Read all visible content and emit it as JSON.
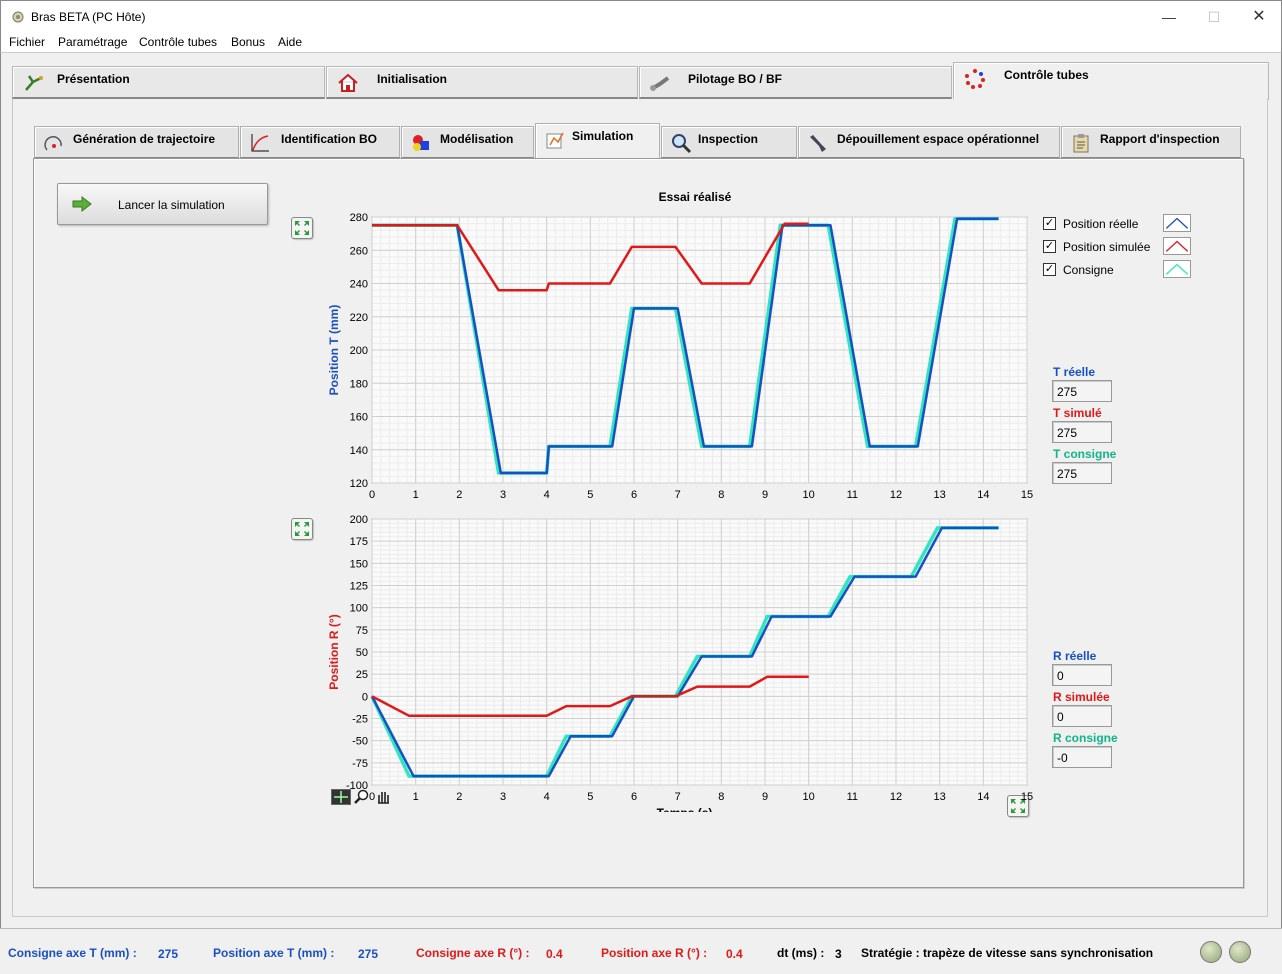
{
  "window": {
    "title": "Bras BETA (PC Hôte)",
    "min_icon": "minimize-icon",
    "max_icon": "maximize-icon",
    "close_icon": "close-icon"
  },
  "menu": [
    "Fichier",
    "Paramétrage",
    "Contrôle tubes",
    "Bonus",
    "Aide"
  ],
  "main_tabs": [
    {
      "label": "Présentation",
      "icon": "presentation-icon"
    },
    {
      "label": "Initialisation",
      "icon": "house-icon"
    },
    {
      "label": "Pilotage BO / BF",
      "icon": "robot-arm-icon"
    },
    {
      "label": "Contrôle tubes",
      "icon": "circle-dots-icon",
      "active": true
    }
  ],
  "sub_tabs": [
    {
      "label": "Génération de trajectoire",
      "icon": "trajectory-icon"
    },
    {
      "label": "Identification BO",
      "icon": "graph-icon"
    },
    {
      "label": "Modélisation",
      "icon": "shapes-icon"
    },
    {
      "label": "Simulation",
      "icon": "simulation-icon",
      "active": true
    },
    {
      "label": "Inspection",
      "icon": "magnifier-icon"
    },
    {
      "label": "Dépouillement espace opérationnel",
      "icon": "tools-icon"
    },
    {
      "label": "Rapport d'inspection",
      "icon": "clipboard-icon"
    }
  ],
  "run_button": {
    "label": "Lancer la simulation"
  },
  "chart_title": "Essai réalisé",
  "legend": [
    {
      "label": "Position réelle",
      "checked": true,
      "color": "#1a4fc4"
    },
    {
      "label": "Position simulée",
      "checked": true,
      "color": "#e01818"
    },
    {
      "label": "Consigne",
      "checked": true,
      "color": "#2ee6c0"
    }
  ],
  "indicators_T": [
    {
      "label": "T réelle",
      "value": "275",
      "color": "#1a4fc4"
    },
    {
      "label": "T simulé",
      "value": "275",
      "color": "#e01818"
    },
    {
      "label": "T consigne",
      "value": "275",
      "color": "#12b48a"
    }
  ],
  "indicators_R": [
    {
      "label": "R réelle",
      "value": "0",
      "color": "#1a4fc4"
    },
    {
      "label": "R simulée",
      "value": "0",
      "color": "#e01818"
    },
    {
      "label": "R consigne",
      "value": "-0",
      "color": "#12b48a"
    }
  ],
  "chart_data": [
    {
      "type": "line",
      "ylabel": "Position T (mm)",
      "ylabel_color": "#1a4fc4",
      "xlim": [
        0,
        15
      ],
      "ylim": [
        120,
        280
      ],
      "xticks": [
        "0",
        "1",
        "2",
        "3",
        "4",
        "5",
        "6",
        "7",
        "8",
        "9",
        "10",
        "11",
        "12",
        "13",
        "14",
        "15"
      ],
      "yticks": [
        "120",
        "140",
        "160",
        "180",
        "200",
        "220",
        "240",
        "260",
        "280"
      ],
      "grid": true,
      "series": [
        {
          "name": "Consigne",
          "color": "#2ee6c0",
          "x": [
            0,
            1.95,
            2.9,
            4.0,
            4.05,
            5.45,
            5.95,
            6.95,
            7.55,
            8.65,
            9.35,
            10.45,
            11.35,
            12.45,
            13.35,
            14.35
          ],
          "y": [
            275,
            275,
            126,
            126,
            142,
            142,
            225,
            225,
            142,
            142,
            275,
            275,
            142,
            142,
            279,
            279
          ]
        },
        {
          "name": "Position réelle",
          "color": "#1a4fc4",
          "x": [
            0,
            1.95,
            2.95,
            4.0,
            4.05,
            5.5,
            6.0,
            7.0,
            7.6,
            8.7,
            9.4,
            10.5,
            11.4,
            12.5,
            13.4,
            14.35
          ],
          "y": [
            275,
            275,
            126,
            126,
            142,
            142,
            225,
            225,
            142,
            142,
            275,
            275,
            142,
            142,
            279,
            279
          ]
        },
        {
          "name": "Position simulée",
          "color": "#e01818",
          "x": [
            0,
            1.95,
            2.9,
            4.0,
            4.05,
            5.45,
            5.95,
            6.95,
            7.55,
            8.65,
            9.45,
            10.0
          ],
          "y": [
            275,
            275,
            236,
            236,
            240,
            240,
            262,
            262,
            240,
            240,
            276,
            276
          ]
        }
      ]
    },
    {
      "type": "line",
      "ylabel": "Position R (°)",
      "ylabel_color": "#e01818",
      "xlabel": "Temps (s)",
      "xlim": [
        0,
        15
      ],
      "ylim": [
        -100,
        200
      ],
      "xticks": [
        "0",
        "1",
        "2",
        "3",
        "4",
        "5",
        "6",
        "7",
        "8",
        "9",
        "10",
        "11",
        "12",
        "13",
        "14",
        "15"
      ],
      "yticks": [
        "-100",
        "-75",
        "-50",
        "-25",
        "0",
        "25",
        "50",
        "75",
        "100",
        "125",
        "150",
        "175",
        "200"
      ],
      "grid": true,
      "series": [
        {
          "name": "Consigne",
          "color": "#2ee6c0",
          "x": [
            0,
            0.85,
            4.0,
            4.45,
            5.45,
            5.95,
            6.95,
            7.45,
            8.65,
            9.05,
            10.45,
            10.95,
            12.35,
            12.95,
            14.35
          ],
          "y": [
            0,
            -90,
            -90,
            -45,
            -45,
            0,
            0,
            45,
            45,
            90,
            90,
            135,
            135,
            190,
            190
          ]
        },
        {
          "name": "Position réelle",
          "color": "#1a4fc4",
          "x": [
            0,
            0.95,
            4.05,
            4.55,
            5.5,
            6.0,
            7.0,
            7.55,
            8.7,
            9.15,
            10.5,
            11.05,
            12.45,
            13.05,
            14.35
          ],
          "y": [
            0,
            -90,
            -90,
            -45,
            -45,
            0,
            0,
            45,
            45,
            90,
            90,
            135,
            135,
            190,
            190
          ]
        },
        {
          "name": "Position simulée",
          "color": "#e01818",
          "x": [
            0,
            0.85,
            4.0,
            4.45,
            5.45,
            5.95,
            6.95,
            7.45,
            8.65,
            9.05,
            10.0
          ],
          "y": [
            0,
            -22,
            -22,
            -11,
            -11,
            0,
            0,
            11,
            11,
            22,
            22
          ]
        }
      ]
    }
  ],
  "status": {
    "consigne_T_label": "Consigne axe T (mm) :",
    "consigne_T_value": "275",
    "position_T_label": "Position axe T (mm) :",
    "position_T_value": "275",
    "consigne_R_label": "Consigne axe R (°) :",
    "consigne_R_value": "0.4",
    "position_R_label": "Position axe R (°) :",
    "position_R_value": "0.4",
    "dt_label": "dt (ms) :",
    "dt_value": "3",
    "strategie": "Stratégie : trapèze de vitesse sans synchronisation",
    "blue": "#1a4fc4",
    "red": "#e01818"
  }
}
